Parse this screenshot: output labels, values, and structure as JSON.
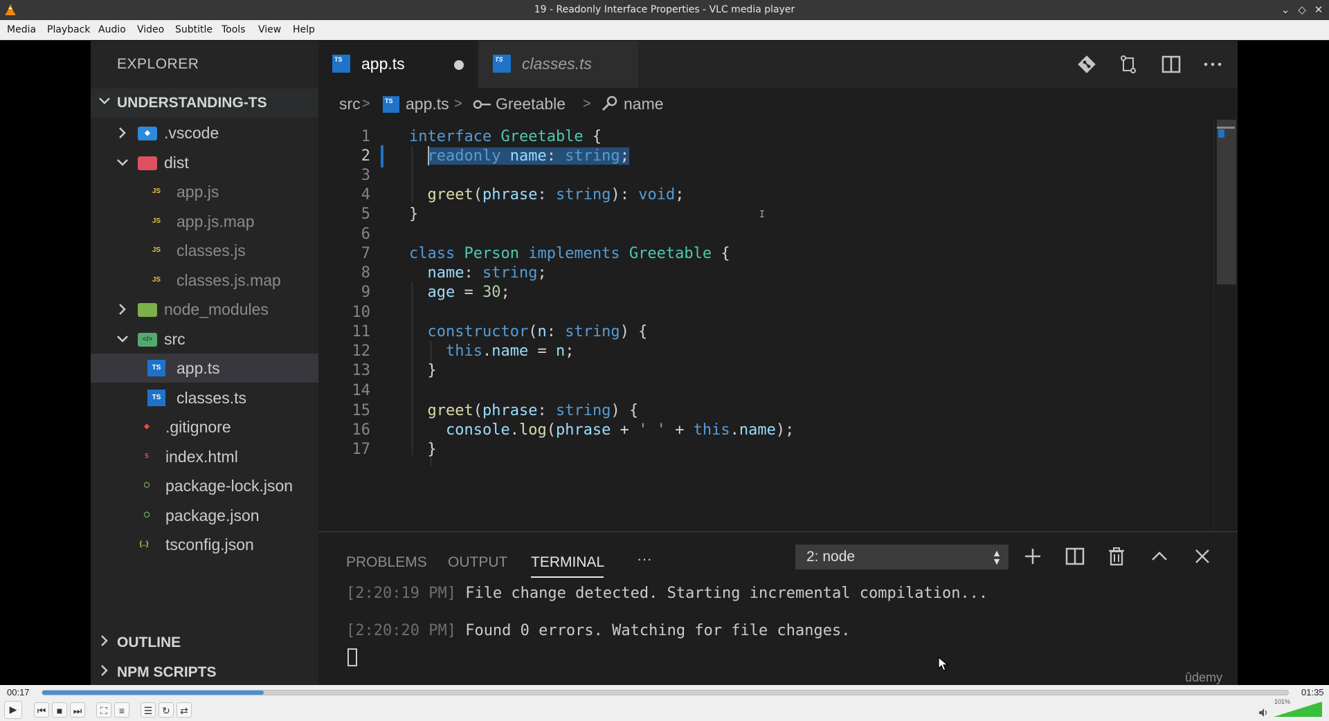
{
  "window": {
    "title": "19 - Readonly Interface Properties - VLC media player"
  },
  "menu": [
    "Media",
    "Playback",
    "Audio",
    "Video",
    "Subtitle",
    "Tools",
    "View",
    "Help"
  ],
  "vscode": {
    "explorer_title": "EXPLORER",
    "project": "UNDERSTANDING-TS",
    "tree": [
      {
        "label": ".vscode",
        "type": "folder",
        "expanded": false,
        "icon": "vscode-folder-icon"
      },
      {
        "label": "dist",
        "type": "folder",
        "expanded": true,
        "icon": "dist-folder-icon"
      },
      {
        "label": "app.js",
        "type": "file",
        "icon": "js-file-icon",
        "dim": true
      },
      {
        "label": "app.js.map",
        "type": "file",
        "icon": "js-map-file-icon",
        "dim": true
      },
      {
        "label": "classes.js",
        "type": "file",
        "icon": "js-file-icon",
        "dim": true
      },
      {
        "label": "classes.js.map",
        "type": "file",
        "icon": "js-map-file-icon",
        "dim": true
      },
      {
        "label": "node_modules",
        "type": "folder",
        "expanded": false,
        "icon": "node-folder-icon",
        "dim": true
      },
      {
        "label": "src",
        "type": "folder",
        "expanded": true,
        "icon": "src-folder-icon"
      },
      {
        "label": "app.ts",
        "type": "file",
        "icon": "ts-file-icon",
        "selected": true
      },
      {
        "label": "classes.ts",
        "type": "file",
        "icon": "ts-file-icon"
      },
      {
        "label": ".gitignore",
        "type": "file",
        "icon": "git-file-icon"
      },
      {
        "label": "index.html",
        "type": "file",
        "icon": "html-file-icon"
      },
      {
        "label": "package-lock.json",
        "type": "file",
        "icon": "npm-file-icon"
      },
      {
        "label": "package.json",
        "type": "file",
        "icon": "npm-file-icon"
      },
      {
        "label": "tsconfig.json",
        "type": "file",
        "icon": "json-file-icon"
      }
    ],
    "outline": "OUTLINE",
    "npm_scripts": "NPM SCRIPTS",
    "tabs": [
      {
        "label": "app.ts",
        "active": true,
        "modified": true,
        "icon_text": "TS"
      },
      {
        "label": "classes.ts",
        "active": false,
        "modified": false,
        "icon_text": "TS"
      }
    ],
    "breadcrumb": [
      "src",
      "app.ts",
      "Greetable",
      "name"
    ],
    "line_numbers": [
      "1",
      "2",
      "3",
      "4",
      "5",
      "6",
      "7",
      "8",
      "9",
      "10",
      "11",
      "12",
      "13",
      "14",
      "15",
      "16",
      "17"
    ],
    "current_line": "2",
    "panel": {
      "tabs": [
        "PROBLEMS",
        "OUTPUT",
        "TERMINAL"
      ],
      "active_tab": "TERMINAL",
      "more": "···",
      "terminal_select": "2: node",
      "lines": [
        {
          "ts": "[2:20:19 PM]",
          "text": " File change detected. Starting incremental compilation..."
        },
        {
          "ts": "[2:20:20 PM]",
          "text": " Found 0 errors. Watching for file changes."
        }
      ]
    },
    "watermark": "ûdemy"
  },
  "player": {
    "elapsed": "00:17",
    "total": "01:35",
    "progress": 0.178,
    "volume_label": "101%",
    "volume": 1.01
  },
  "colors": {
    "keyword": "#569cd6",
    "type": "#4ec9b0",
    "function": "#dcdcaa",
    "property": "#9cdcfe",
    "number": "#b5cea8",
    "string": "#ce9178",
    "seek_fill": "#4a8ed6"
  }
}
